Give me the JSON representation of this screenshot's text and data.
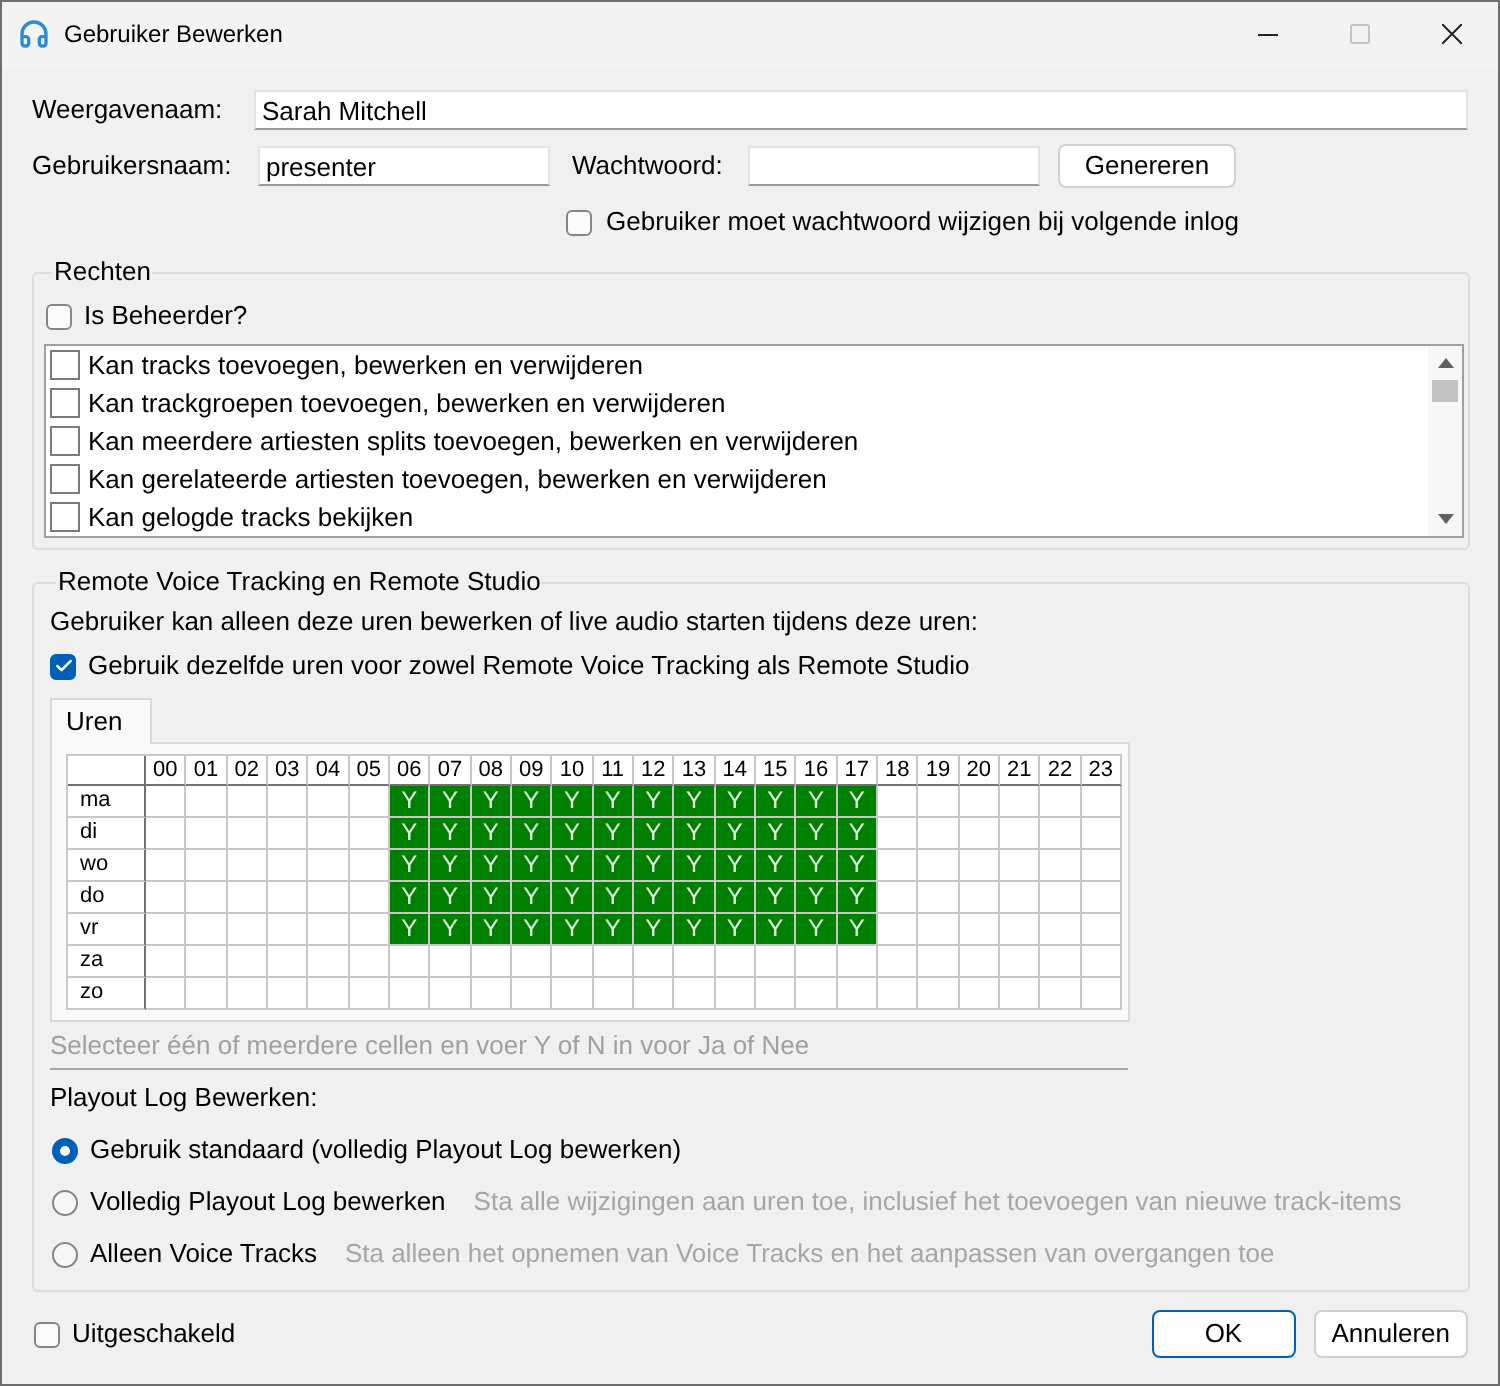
{
  "window": {
    "title": "Gebruiker Bewerken",
    "maximize_disabled": true
  },
  "display_name": {
    "label": "Weergavenaam:",
    "value": "Sarah Mitchell"
  },
  "username": {
    "label": "Gebruikersnaam:",
    "value": "presenter"
  },
  "password": {
    "label": "Wachtwoord:"
  },
  "generate_button": {
    "label": "Genereren"
  },
  "must_change_password": {
    "label": "Gebruiker moet wachtwoord wijzigen bij volgende inlog",
    "checked": false
  },
  "rights": {
    "title": "Rechten",
    "is_admin": {
      "label": "Is Beheerder?",
      "checked": false
    },
    "items": [
      {
        "label": "Kan tracks toevoegen, bewerken en verwijderen",
        "checked": false
      },
      {
        "label": "Kan trackgroepen toevoegen, bewerken en verwijderen",
        "checked": false
      },
      {
        "label": "Kan meerdere artiesten splits toevoegen, bewerken en verwijderen",
        "checked": false
      },
      {
        "label": "Kan gerelateerde artiesten toevoegen, bewerken en verwijderen",
        "checked": false
      },
      {
        "label": "Kan gelogde tracks bekijken",
        "checked": false
      }
    ]
  },
  "remote": {
    "title": "Remote Voice Tracking en Remote Studio",
    "description": "Gebruiker kan alleen deze uren bewerken of live audio starten tijdens deze uren:",
    "same_hours": {
      "label": "Gebruik dezelfde uren voor zowel Remote Voice Tracking als Remote Studio",
      "checked": true
    },
    "tabs": [
      {
        "label": "Uren",
        "selected": true
      }
    ],
    "schedule": {
      "columns": [
        "00",
        "01",
        "02",
        "03",
        "04",
        "05",
        "06",
        "07",
        "08",
        "09",
        "10",
        "11",
        "12",
        "13",
        "14",
        "15",
        "16",
        "17",
        "18",
        "19",
        "20",
        "21",
        "22",
        "23"
      ],
      "rows": [
        {
          "day": "ma",
          "cells": [
            {
              "on": false
            },
            {
              "on": false
            },
            {
              "on": false
            },
            {
              "on": false
            },
            {
              "on": false
            },
            {
              "on": false
            },
            {
              "value": "Y",
              "on": true
            },
            {
              "value": "Y",
              "on": true
            },
            {
              "value": "Y",
              "on": true
            },
            {
              "value": "Y",
              "on": true
            },
            {
              "value": "Y",
              "on": true
            },
            {
              "value": "Y",
              "on": true
            },
            {
              "value": "Y",
              "on": true
            },
            {
              "value": "Y",
              "on": true
            },
            {
              "value": "Y",
              "on": true
            },
            {
              "value": "Y",
              "on": true
            },
            {
              "value": "Y",
              "on": true
            },
            {
              "value": "Y",
              "on": true
            },
            {
              "on": false
            },
            {
              "on": false
            },
            {
              "on": false
            },
            {
              "on": false
            },
            {
              "on": false
            },
            {
              "on": false
            }
          ]
        },
        {
          "day": "di",
          "cells": [
            {
              "on": false
            },
            {
              "on": false
            },
            {
              "on": false
            },
            {
              "on": false
            },
            {
              "on": false
            },
            {
              "on": false
            },
            {
              "value": "Y",
              "on": true
            },
            {
              "value": "Y",
              "on": true
            },
            {
              "value": "Y",
              "on": true
            },
            {
              "value": "Y",
              "on": true
            },
            {
              "value": "Y",
              "on": true
            },
            {
              "value": "Y",
              "on": true
            },
            {
              "value": "Y",
              "on": true
            },
            {
              "value": "Y",
              "on": true
            },
            {
              "value": "Y",
              "on": true
            },
            {
              "value": "Y",
              "on": true
            },
            {
              "value": "Y",
              "on": true
            },
            {
              "value": "Y",
              "on": true
            },
            {
              "on": false
            },
            {
              "on": false
            },
            {
              "on": false
            },
            {
              "on": false
            },
            {
              "on": false
            },
            {
              "on": false
            }
          ]
        },
        {
          "day": "wo",
          "cells": [
            {
              "on": false
            },
            {
              "on": false
            },
            {
              "on": false
            },
            {
              "on": false
            },
            {
              "on": false
            },
            {
              "on": false
            },
            {
              "value": "Y",
              "on": true
            },
            {
              "value": "Y",
              "on": true
            },
            {
              "value": "Y",
              "on": true
            },
            {
              "value": "Y",
              "on": true
            },
            {
              "value": "Y",
              "on": true
            },
            {
              "value": "Y",
              "on": true
            },
            {
              "value": "Y",
              "on": true
            },
            {
              "value": "Y",
              "on": true
            },
            {
              "value": "Y",
              "on": true
            },
            {
              "value": "Y",
              "on": true
            },
            {
              "value": "Y",
              "on": true
            },
            {
              "value": "Y",
              "on": true
            },
            {
              "on": false
            },
            {
              "on": false
            },
            {
              "on": false
            },
            {
              "on": false
            },
            {
              "on": false
            },
            {
              "on": false
            }
          ]
        },
        {
          "day": "do",
          "cells": [
            {
              "on": false
            },
            {
              "on": false
            },
            {
              "on": false
            },
            {
              "on": false
            },
            {
              "on": false
            },
            {
              "on": false
            },
            {
              "value": "Y",
              "on": true
            },
            {
              "value": "Y",
              "on": true
            },
            {
              "value": "Y",
              "on": true
            },
            {
              "value": "Y",
              "on": true
            },
            {
              "value": "Y",
              "on": true
            },
            {
              "value": "Y",
              "on": true
            },
            {
              "value": "Y",
              "on": true
            },
            {
              "value": "Y",
              "on": true
            },
            {
              "value": "Y",
              "on": true
            },
            {
              "value": "Y",
              "on": true
            },
            {
              "value": "Y",
              "on": true
            },
            {
              "value": "Y",
              "on": true
            },
            {
              "on": false
            },
            {
              "on": false
            },
            {
              "on": false
            },
            {
              "on": false
            },
            {
              "on": false
            },
            {
              "on": false
            }
          ]
        },
        {
          "day": "vr",
          "cells": [
            {
              "on": false
            },
            {
              "on": false
            },
            {
              "on": false
            },
            {
              "on": false
            },
            {
              "on": false
            },
            {
              "on": false
            },
            {
              "value": "Y",
              "on": true
            },
            {
              "value": "Y",
              "on": true
            },
            {
              "value": "Y",
              "on": true
            },
            {
              "value": "Y",
              "on": true
            },
            {
              "value": "Y",
              "on": true
            },
            {
              "value": "Y",
              "on": true
            },
            {
              "value": "Y",
              "on": true
            },
            {
              "value": "Y",
              "on": true
            },
            {
              "value": "Y",
              "on": true
            },
            {
              "value": "Y",
              "on": true
            },
            {
              "value": "Y",
              "on": true
            },
            {
              "value": "Y",
              "on": true
            },
            {
              "on": false
            },
            {
              "on": false
            },
            {
              "on": false
            },
            {
              "on": false
            },
            {
              "on": false
            },
            {
              "on": false
            }
          ]
        },
        {
          "day": "za",
          "cells": [
            {
              "on": false
            },
            {
              "on": false
            },
            {
              "on": false
            },
            {
              "on": false
            },
            {
              "on": false
            },
            {
              "on": false
            },
            {
              "on": false
            },
            {
              "on": false
            },
            {
              "on": false
            },
            {
              "on": false
            },
            {
              "on": false
            },
            {
              "on": false
            },
            {
              "on": false
            },
            {
              "on": false
            },
            {
              "on": false
            },
            {
              "on": false
            },
            {
              "on": false
            },
            {
              "on": false
            },
            {
              "on": false
            },
            {
              "on": false
            },
            {
              "on": false
            },
            {
              "on": false
            },
            {
              "on": false
            },
            {
              "on": false
            }
          ]
        },
        {
          "day": "zo",
          "cells": [
            {
              "on": false
            },
            {
              "on": false
            },
            {
              "on": false
            },
            {
              "on": false
            },
            {
              "on": false
            },
            {
              "on": false
            },
            {
              "on": false
            },
            {
              "on": false
            },
            {
              "on": false
            },
            {
              "on": false
            },
            {
              "on": false
            },
            {
              "on": false
            },
            {
              "on": false
            },
            {
              "on": false
            },
            {
              "on": false
            },
            {
              "on": false
            },
            {
              "on": false
            },
            {
              "on": false
            },
            {
              "on": false
            },
            {
              "on": false
            },
            {
              "on": false
            },
            {
              "on": false
            },
            {
              "on": false
            },
            {
              "on": false
            }
          ]
        }
      ]
    },
    "hint": "Selecteer één of meerdere cellen en voer Y of N in voor Ja of Nee",
    "playout_log": {
      "title": "Playout Log Bewerken:",
      "options": [
        {
          "label": "Gebruik standaard (volledig Playout Log bewerken)",
          "selected": true
        },
        {
          "label": "Volledig Playout Log bewerken",
          "description": "Sta alle wijzigingen aan uren toe, inclusief het toevoegen van nieuwe track-items",
          "selected": false
        },
        {
          "label": "Alleen Voice Tracks",
          "description": "Sta alleen het opnemen van Voice Tracks en het aanpassen van overgangen toe",
          "selected": false
        }
      ]
    }
  },
  "disabled": {
    "label": "Uitgeschakeld",
    "checked": false
  },
  "buttons": [
    {
      "label": "OK",
      "default": true
    },
    {
      "label": "Annuleren",
      "default": false
    }
  ]
}
